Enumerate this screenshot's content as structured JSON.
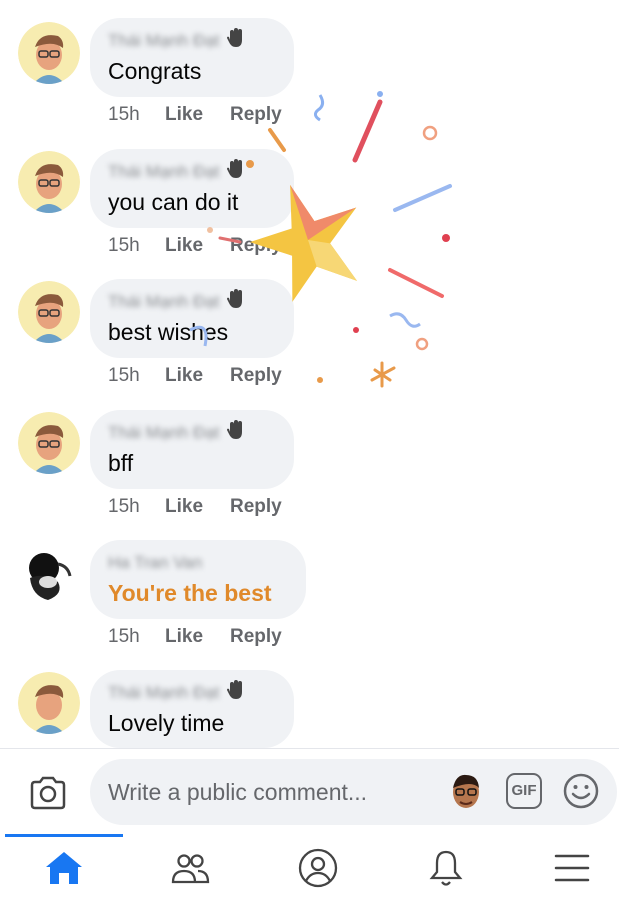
{
  "comments": [
    {
      "author": "Thái Mạnh Đạt",
      "text": "Congrats",
      "time": "15h",
      "like": "Like",
      "reply": "Reply"
    },
    {
      "author": "Thái Mạnh Đạt",
      "text": "you can do it",
      "time": "15h",
      "like": "Like",
      "reply": "Reply"
    },
    {
      "author": "Thái Mạnh Đạt",
      "text": "best wishes",
      "time": "15h",
      "like": "Like",
      "reply": "Reply"
    },
    {
      "author": "Thái Mạnh Đạt",
      "text": "bff",
      "time": "15h",
      "like": "Like",
      "reply": "Reply"
    },
    {
      "author": "Ha Tran Van",
      "text": "You're the best",
      "time": "15h",
      "like": "Like",
      "reply": "Reply"
    },
    {
      "author": "Thái Mạnh Đạt",
      "text": "Lovely time",
      "time": "",
      "like": "",
      "reply": ""
    }
  ],
  "composer": {
    "placeholder": "Write a public comment...",
    "gif_label": "GIF"
  },
  "tabs": [
    "home-icon",
    "friends-icon",
    "profile-icon",
    "notifications-icon",
    "menu-icon"
  ],
  "colors": {
    "accent": "#1877f2",
    "highlight_text": "#e0892a",
    "bubble": "#f0f2f5",
    "meta": "#65676b"
  }
}
